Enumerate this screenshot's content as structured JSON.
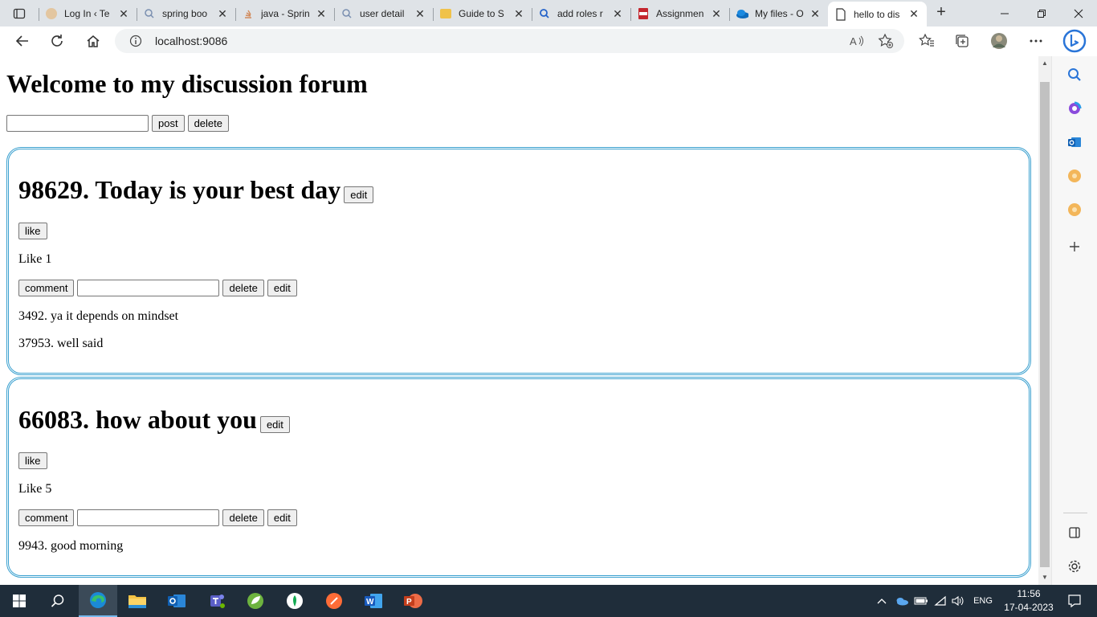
{
  "browser": {
    "tabs": [
      {
        "title": "Log In ‹ Te",
        "icon": "wordpress-icon"
      },
      {
        "title": "spring boo",
        "icon": "search-icon"
      },
      {
        "title": "java - Sprin",
        "icon": "stackoverflow-icon"
      },
      {
        "title": "user detail",
        "icon": "search-icon"
      },
      {
        "title": "Guide to S",
        "icon": "baeldung-icon"
      },
      {
        "title": "add roles r",
        "icon": "search-icon"
      },
      {
        "title": "Assignmen",
        "icon": "pdf-icon"
      },
      {
        "title": "My files - O",
        "icon": "onedrive-icon"
      },
      {
        "title": "hello to dis",
        "icon": "page-icon"
      }
    ],
    "url": "localhost:9086"
  },
  "page": {
    "heading": "Welcome to my discussion forum",
    "post_button": "post",
    "delete_button": "delete",
    "posts": [
      {
        "title": "98629. Today is your best day",
        "edit_label": "edit",
        "like_button": "like",
        "likes_text": "Like 1",
        "comment_button": "comment",
        "delete_label": "delete",
        "edit_comment_label": "edit",
        "comments": [
          "3492. ya it depends on mindset",
          "37953. well said"
        ]
      },
      {
        "title": "66083. how about you",
        "edit_label": "edit",
        "like_button": "like",
        "likes_text": "Like 5",
        "comment_button": "comment",
        "delete_label": "delete",
        "edit_comment_label": "edit",
        "comments": [
          "9943. good morning"
        ]
      }
    ]
  },
  "taskbar": {
    "language": "ENG",
    "time": "11:56",
    "date": "17-04-2023"
  },
  "colors": {
    "card_border": "#3aa0cf",
    "taskbar_bg": "#1f2d3a",
    "tabstrip_bg": "#dfe3e7"
  }
}
